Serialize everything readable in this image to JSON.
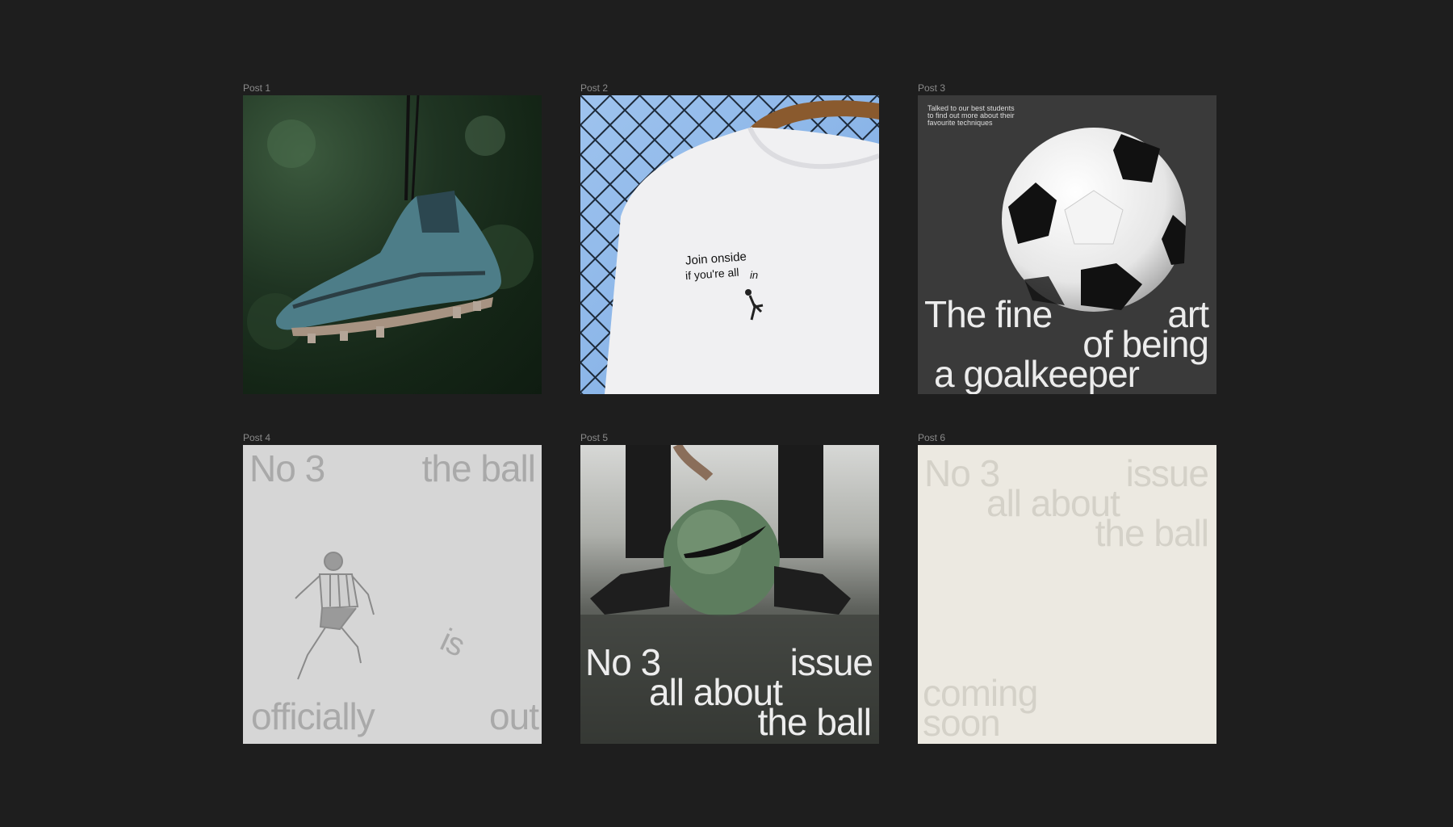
{
  "posts": [
    {
      "label": "Post 1"
    },
    {
      "label": "Post 2",
      "shirt_text_1": "Join onside",
      "shirt_text_2": "if you're all",
      "shirt_text_3": "in"
    },
    {
      "label": "Post 3",
      "small_text_1": "Talked to our best students",
      "small_text_2": "to find out more about their",
      "small_text_3": "favourite techniques",
      "line1a": "The fine",
      "line1b": "art",
      "line2": "of being",
      "line3": "a goalkeeper"
    },
    {
      "label": "Post 4",
      "top_left": "No 3",
      "top_right": "the ball",
      "middle": "is",
      "bottom_left": "officially",
      "bottom_right": "out"
    },
    {
      "label": "Post 5",
      "line1a": "No 3",
      "line1b": "issue",
      "line2": "all about",
      "line3": "the ball"
    },
    {
      "label": "Post 6",
      "line1a": "No 3",
      "line1b": "issue",
      "line2": "all about",
      "line3": "the ball",
      "bottom1": "coming",
      "bottom2": "soon"
    }
  ],
  "colors": {
    "background": "#1e1e1e",
    "post3_bg": "#3a3a3a",
    "post4_bg": "#d6d6d6",
    "post6_bg": "#ece9e1"
  }
}
